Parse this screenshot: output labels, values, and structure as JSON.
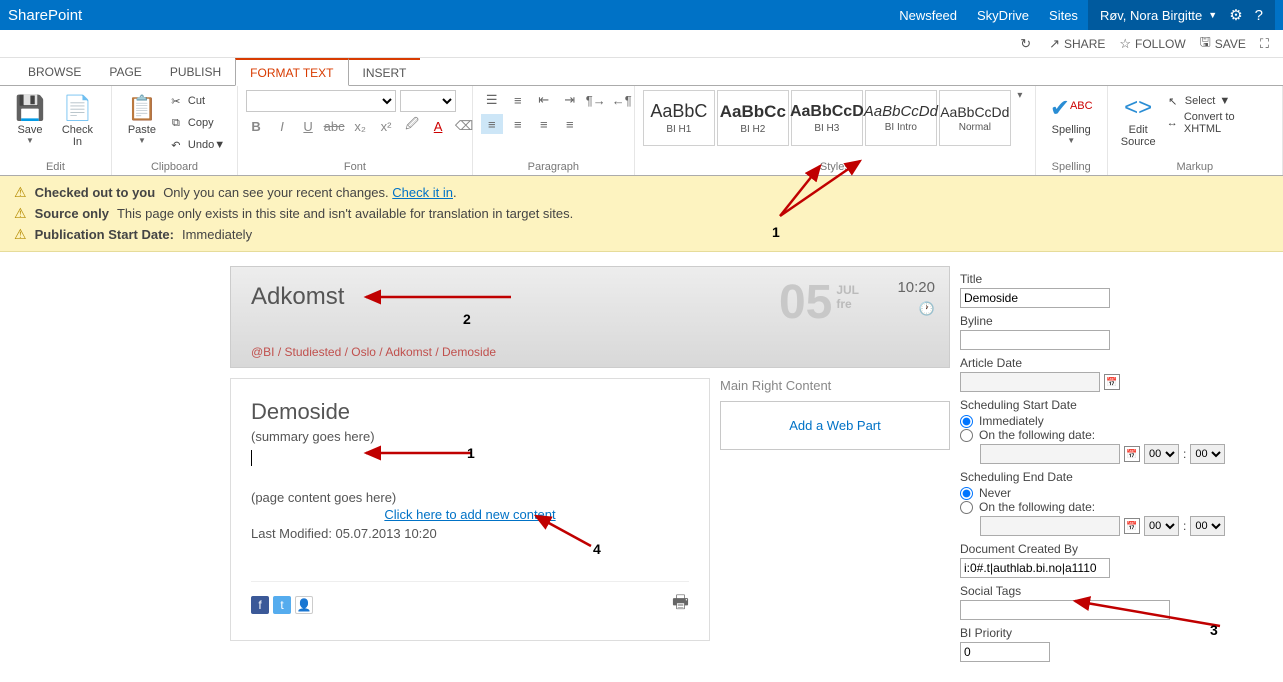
{
  "topbar": {
    "brand": "SharePoint",
    "links": {
      "newsfeed": "Newsfeed",
      "skydrive": "SkyDrive",
      "sites": "Sites"
    },
    "user": "Røv, Nora Birgitte"
  },
  "pageActions": {
    "share": "SHARE",
    "follow": "FOLLOW",
    "save": "SAVE"
  },
  "ribbonTabs": {
    "browse": "BROWSE",
    "page": "PAGE",
    "publish": "PUBLISH",
    "formatText": "FORMAT TEXT",
    "insert": "INSERT"
  },
  "ribbon": {
    "edit": {
      "label": "Edit",
      "save": "Save",
      "checkIn": "Check In"
    },
    "clipboard": {
      "label": "Clipboard",
      "paste": "Paste",
      "cut": "Cut",
      "copy": "Copy",
      "undo": "Undo"
    },
    "font": {
      "label": "Font"
    },
    "paragraph": {
      "label": "Paragraph"
    },
    "styles": {
      "label": "Styles",
      "items": [
        {
          "prev": "AaBbC",
          "name": "BI H1",
          "weight": "normal",
          "style": "normal"
        },
        {
          "prev": "AaBbCc",
          "name": "BI H2",
          "weight": "bold",
          "style": "normal"
        },
        {
          "prev": "AaBbCcD",
          "name": "BI H3",
          "weight": "bold",
          "style": "normal"
        },
        {
          "prev": "AaBbCcDd",
          "name": "BI Intro",
          "weight": "normal",
          "style": "italic"
        },
        {
          "prev": "AaBbCcDd",
          "name": "Normal",
          "weight": "normal",
          "style": "normal"
        }
      ]
    },
    "spelling": {
      "label": "Spelling",
      "btn": "Spelling"
    },
    "markup": {
      "label": "Markup",
      "editSource": "Edit\nSource",
      "select": "Select",
      "convert": "Convert to XHTML"
    }
  },
  "notifications": {
    "row1": {
      "bold": "Checked out to you",
      "text": "Only you can see your recent changes.",
      "link": "Check it in"
    },
    "row2": {
      "bold": "Source only",
      "text": "This page only exists in this site and isn't available for translation in target sites."
    },
    "row3": {
      "bold": "Publication Start Date:",
      "text": "Immediately"
    }
  },
  "annotations": {
    "n1": "1",
    "n2": "2",
    "n1b": "1",
    "n4": "4",
    "n3": "3"
  },
  "header": {
    "category": "Adkomst",
    "dayNum": "05",
    "month": "JUL",
    "weekday": "fre",
    "time": "10:20"
  },
  "breadcrumb": {
    "p1": "@BI",
    "p2": "Studiested",
    "p3": "Oslo",
    "p4": "Adkomst",
    "p5": "Demoside"
  },
  "editor": {
    "title": "Demoside",
    "summary": "(summary goes here)",
    "contentPh": "(page content goes here)",
    "addLink": "Click here to add new content",
    "lastMod": "Last Modified: 05.07.2013 10:20"
  },
  "sideEditor": {
    "label": "Main Right Content",
    "addWebPart": "Add a Web Part"
  },
  "props": {
    "titleLabel": "Title",
    "titleVal": "Demoside",
    "bylineLabel": "Byline",
    "bylineVal": "",
    "articleDateLabel": "Article Date",
    "schedStartLabel": "Scheduling Start Date",
    "immediately": "Immediately",
    "onFollowing": "On the following date:",
    "schedEndLabel": "Scheduling End Date",
    "never": "Never",
    "docCreatedLabel": "Document Created By",
    "docCreatedVal": "i:0#.t|authlab.bi.no|a1110",
    "socialTagsLabel": "Social Tags",
    "biPriorityLabel": "BI Priority",
    "biPriorityVal": "0",
    "hour00": "00",
    "colon": ":"
  }
}
